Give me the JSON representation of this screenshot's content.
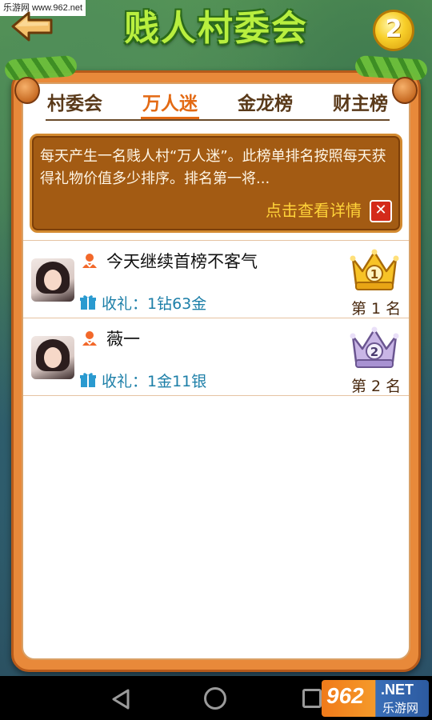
{
  "watermark": {
    "top_left": "乐游网 www.962.net"
  },
  "header": {
    "title": "贱人村委会",
    "coin_glyph": "2"
  },
  "tabs": [
    {
      "label": "村委会",
      "active": false
    },
    {
      "label": "万人迷",
      "active": true
    },
    {
      "label": "金龙榜",
      "active": false
    },
    {
      "label": "财主榜",
      "active": false
    }
  ],
  "info": {
    "text": "每天产生一名贱人村“万人迷”。此榜单排名按照每天获得礼物价值多少排序。排名第一将...",
    "detail_label": "点击查看详情",
    "close_glyph": "✕"
  },
  "ranking": [
    {
      "name": "今天继续首榜不客气",
      "gift_label": "收礼：1钻63金",
      "place": "第 1 名",
      "crown_number": "1",
      "crown": "gold-crown-icon"
    },
    {
      "name": "薇一",
      "gift_label": "收礼：1金11银",
      "place": "第 2 名",
      "crown_number": "2",
      "crown": "silver-crown-icon"
    }
  ],
  "watermark_logo": {
    "number": "962",
    "net": ".NET",
    "cn": "乐游网"
  },
  "colors": {
    "accent": "#e36a14",
    "board": "#e8893a",
    "info_bg": "#a35b13",
    "gift_text": "#1d7fa8"
  }
}
